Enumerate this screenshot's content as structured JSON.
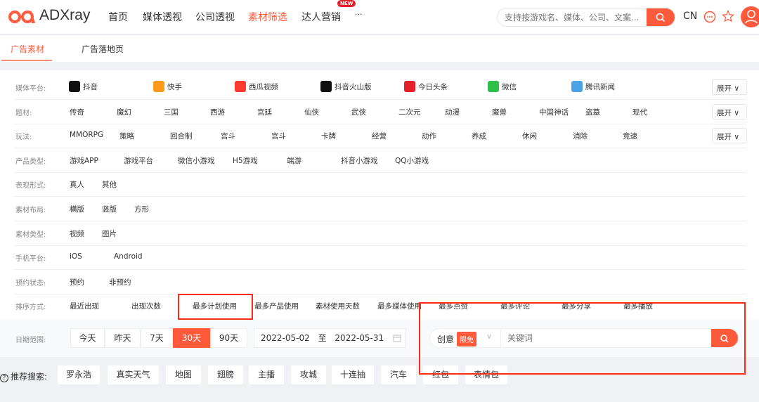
{
  "header": {
    "logo": "ADXray",
    "nav": [
      {
        "label": "首页"
      },
      {
        "label": "媒体透视"
      },
      {
        "label": "公司透视"
      },
      {
        "label": "素材筛选",
        "active": true
      },
      {
        "label": "达人营销",
        "badge": "NEW"
      },
      {
        "label": "···"
      }
    ],
    "search_placeholder": "支持按游戏名、媒体、公司、文案...",
    "lang": "CN",
    "accent": "#ff5a3c"
  },
  "tabs": [
    {
      "label": "广告素材",
      "active": true
    },
    {
      "label": "广告落地页"
    }
  ],
  "filters": [
    {
      "label": "媒体平台:",
      "items": [
        "抖音",
        "快手",
        "西瓜视频",
        "抖音火山版",
        "今日头条",
        "微信",
        "腾讯新闻"
      ],
      "icons": [
        "douyin-icon",
        "kuaishou-icon",
        "xigua-icon",
        "huoshan-icon",
        "toutiao-icon",
        "wechat-icon",
        "tencent-news-icon"
      ],
      "expand": "展开"
    },
    {
      "label": "题材:",
      "items": [
        "传奇",
        "魔幻",
        "三国",
        "西游",
        "宫廷",
        "仙侠",
        "武侠",
        "二次元",
        "动漫",
        "魔兽",
        "中国神话",
        "盗墓",
        "现代"
      ],
      "expand": "展开"
    },
    {
      "label": "玩法:",
      "items": [
        "MMORPG",
        "策略",
        "回合制",
        "宫斗",
        "宫斗",
        "卡牌",
        "经营",
        "动作",
        "养成",
        "休闲",
        "消除",
        "竞速"
      ],
      "expand": "展开"
    },
    {
      "label": "产品类型:",
      "items": [
        "游戏APP",
        "游戏平台",
        "微信小游戏",
        "H5游戏",
        "端游",
        "抖音小游戏",
        "QQ小游戏"
      ]
    },
    {
      "label": "表现形式:",
      "items": [
        "真人",
        "其他"
      ]
    },
    {
      "label": "素材布局:",
      "items": [
        "横版",
        "竖版",
        "方形"
      ]
    },
    {
      "label": "素材类型:",
      "items": [
        "视频",
        "图片"
      ]
    },
    {
      "label": "手机平台:",
      "items": [
        "iOS",
        "Android"
      ]
    },
    {
      "label": "预约状态:",
      "items": [
        "预约",
        "非预约"
      ]
    },
    {
      "label": "排序方式:",
      "items": [
        "最近出现",
        "出现次数",
        "最多计划使用",
        "最多产品使用",
        "素材使用天数",
        "最多媒体使用",
        "最多点赞",
        "最多评论",
        "最多分享",
        "最多播放"
      ]
    }
  ],
  "date": {
    "label": "日期范围:",
    "options": [
      "今天",
      "昨天",
      "7天",
      "30天",
      "90天"
    ],
    "selected": "30天",
    "start": "2022-05-02",
    "sep": "至",
    "end": "2022-05-31"
  },
  "keyword": {
    "type": "创意",
    "badge": "限免",
    "placeholder": "关键词"
  },
  "recommend": {
    "label": "推荐搜索:",
    "tags": [
      "罗永浩",
      "真实天气",
      "地图",
      "翅膀",
      "主播",
      "攻城",
      "十连抽",
      "汽车",
      "红包",
      "表情包"
    ]
  }
}
